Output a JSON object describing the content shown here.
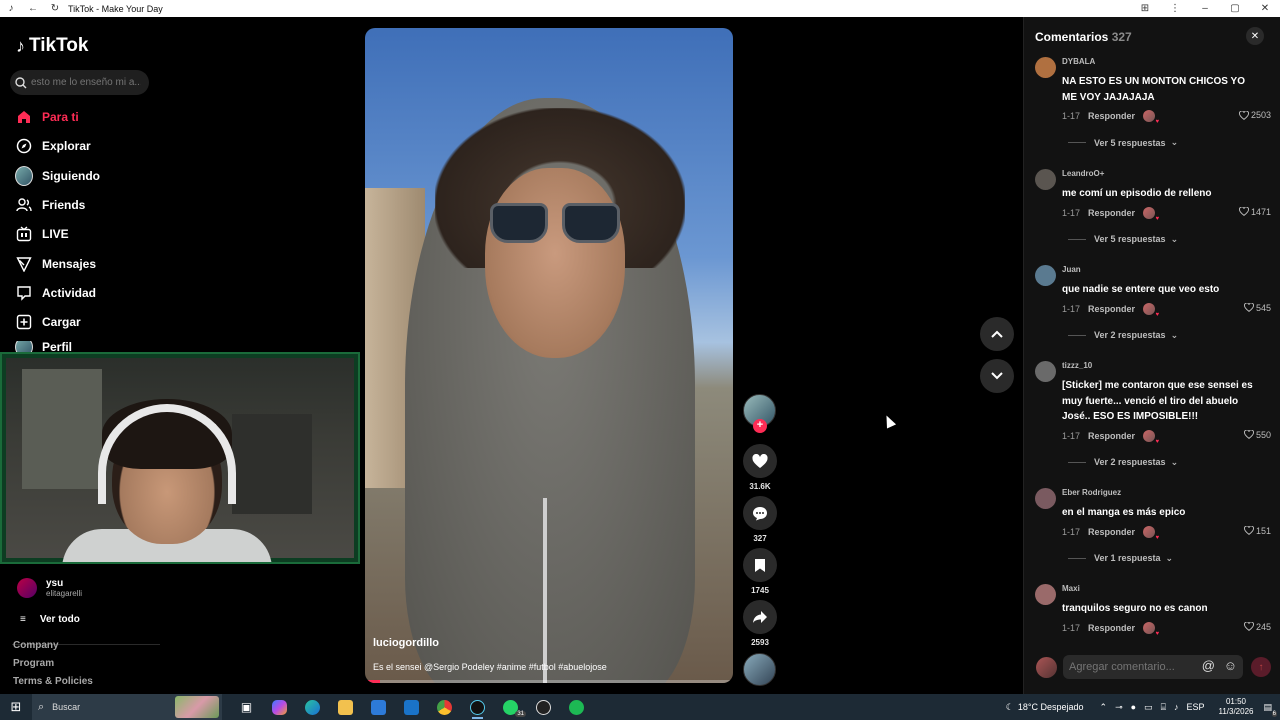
{
  "window": {
    "title": "TikTok - Make Your Day"
  },
  "sidebar": {
    "logo": "TikTok",
    "search_placeholder": "esto me lo enseño mi a...",
    "nav": [
      {
        "label": "Para ti",
        "icon": "home-icon",
        "active": true
      },
      {
        "label": "Explorar",
        "icon": "compass-icon"
      },
      {
        "label": "Siguiendo",
        "icon": "avatar-icon"
      },
      {
        "label": "Friends",
        "icon": "friends-icon"
      },
      {
        "label": "LIVE",
        "icon": "live-icon"
      },
      {
        "label": "Mensajes",
        "icon": "send-icon"
      },
      {
        "label": "Actividad",
        "icon": "inbox-icon"
      },
      {
        "label": "Cargar",
        "icon": "plus-square-icon"
      },
      {
        "label": "Perfil",
        "icon": "profile-icon"
      }
    ],
    "following": {
      "name": "ysu",
      "handle": "elitagarelli"
    },
    "see_all": "Ver todo",
    "footer": [
      "Company",
      "Program",
      "Terms & Policies"
    ]
  },
  "video": {
    "author": "luciogordillo",
    "caption": "Es el sensei @Sergio Podeley #anime #futbol #abuelojose",
    "progress": 0.04
  },
  "actions": {
    "likes": "31.6K",
    "comments": "327",
    "saves": "1745",
    "shares": "2593"
  },
  "comments_panel": {
    "title": "Comentarios",
    "count": "327",
    "reply_label": "Responder",
    "input_placeholder": "Agregar comentario...",
    "items": [
      {
        "user": "DYBALA",
        "text": "NA ESTO ES UN MONTON CHICOS YO ME VOY JAJAJAJA",
        "date": "1-17",
        "likes": "2503",
        "more": "Ver 5 respuestas",
        "avatar_color": "#b07040"
      },
      {
        "user": "LeandroO+",
        "text": "me comí un episodio de relleno",
        "date": "1-17",
        "likes": "1471",
        "more": "Ver 5 respuestas",
        "avatar_color": "#5a5550"
      },
      {
        "user": "Juan",
        "text": "que nadie se entere que veo esto",
        "date": "1-17",
        "likes": "545",
        "more": "Ver 2 respuestas",
        "avatar_color": "#5a7a90"
      },
      {
        "user": "tizzz_10",
        "text": "[Sticker] me contaron que ese sensei es muy fuerte... venció el tiro del abuelo José.. ESO ES IMPOSIBLE!!!",
        "date": "1-17",
        "likes": "550",
        "more": "Ver 2 respuestas",
        "avatar_color": "#6a6a6a"
      },
      {
        "user": "Eber Rodriguez",
        "text": "en el manga es más epico",
        "date": "1-17",
        "likes": "151",
        "more": "Ver 1 respuesta",
        "avatar_color": "#7a5a60"
      },
      {
        "user": "Maxi",
        "text": "tranquilos seguro no es canon",
        "date": "1-17",
        "likes": "245",
        "more": "",
        "avatar_color": "#9a6a6a"
      }
    ]
  },
  "taskbar": {
    "search_label": "Buscar",
    "weather": "18°C  Despejado",
    "language": "ESP",
    "time": "01:50",
    "date": "11/3/2026",
    "whatsapp_badge": "31",
    "notification_badge": "6"
  },
  "colors": {
    "accent": "#fe2c55",
    "panel": "#121212",
    "taskbar": "#1d2a35"
  }
}
